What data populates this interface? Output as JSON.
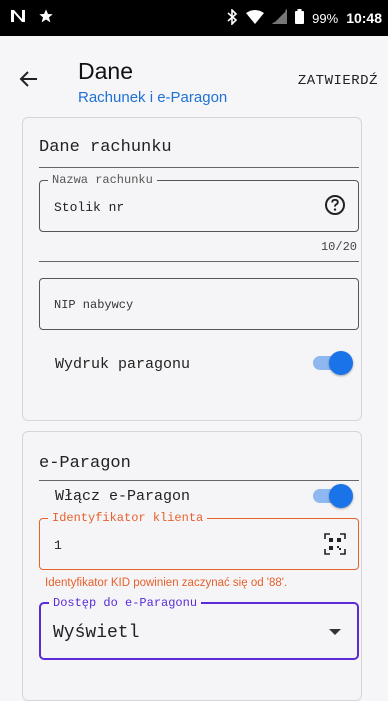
{
  "status_bar": {
    "battery": "99%",
    "time": "10:48",
    "icons": [
      "n-notification-icon",
      "star-icon",
      "bluetooth-icon",
      "wifi-icon",
      "signal-icon",
      "battery-icon"
    ]
  },
  "header": {
    "title": "Dane",
    "subtitle": "Rachunek i e-Paragon",
    "confirm_label": "ZATWIERDŹ",
    "back_icon": "arrow-left-icon"
  },
  "bill_section": {
    "title": "Dane rachunku",
    "name_field": {
      "label": "Nazwa rachunku",
      "value": "Stolik nr",
      "counter": "10/20",
      "help_icon": "help-circle-icon"
    },
    "nip_field": {
      "placeholder": "NIP nabywcy"
    },
    "print_receipt": {
      "label": "Wydruk paragonu",
      "enabled": true
    }
  },
  "eparagon_section": {
    "title": "e-Paragon",
    "enable_toggle": {
      "label": "Włącz e-Paragon",
      "enabled": true
    },
    "client_id_field": {
      "label": "Identyfikator klienta",
      "value": "1",
      "error": "Identyfikator KID powinien zaczynać się od '88'.",
      "scan_icon": "qr-scan-icon"
    },
    "access_select": {
      "label": "Dostęp do e-Paragonu",
      "value": "Wyświetl"
    }
  },
  "colors": {
    "accent_blue": "#1a73e8",
    "subtitle_blue": "#1e72d4",
    "error_orange": "#e8602c",
    "focus_purple": "#5a2bd6"
  }
}
